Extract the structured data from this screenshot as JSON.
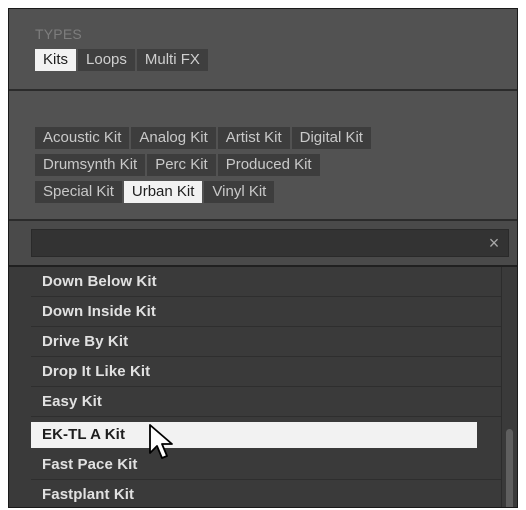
{
  "types": {
    "section_label": "TYPES",
    "items": [
      {
        "label": "Kits",
        "selected": true
      },
      {
        "label": "Loops",
        "selected": false
      },
      {
        "label": "Multi FX",
        "selected": false
      }
    ]
  },
  "tags": {
    "row1": [
      {
        "label": "Acoustic Kit",
        "selected": false
      },
      {
        "label": "Analog Kit",
        "selected": false
      },
      {
        "label": "Artist Kit",
        "selected": false
      },
      {
        "label": "Digital Kit",
        "selected": false
      }
    ],
    "row2": [
      {
        "label": "Drumsynth Kit",
        "selected": false
      },
      {
        "label": "Perc Kit",
        "selected": false
      },
      {
        "label": "Produced Kit",
        "selected": false
      }
    ],
    "row3": [
      {
        "label": "Special Kit",
        "selected": false
      },
      {
        "label": "Urban Kit",
        "selected": true
      },
      {
        "label": "Vinyl Kit",
        "selected": false
      }
    ]
  },
  "search": {
    "value": "",
    "placeholder": "",
    "clear_glyph": "×"
  },
  "results": [
    {
      "label": "Down Below Kit",
      "selected": false
    },
    {
      "label": "Down Inside Kit",
      "selected": false
    },
    {
      "label": "Drive By Kit",
      "selected": false
    },
    {
      "label": "Drop It Like Kit",
      "selected": false
    },
    {
      "label": "Easy Kit",
      "selected": false
    },
    {
      "label": "EK-TL A Kit",
      "selected": true
    },
    {
      "label": "Fast Pace Kit",
      "selected": false
    },
    {
      "label": "Fastplant Kit",
      "selected": false
    }
  ],
  "icons": {
    "clear": "close-icon",
    "pointer": "mouse-pointer-icon"
  },
  "colors": {
    "panel_bg": "#525252",
    "list_bg": "#3a3a3a",
    "selected_bg": "#f2f2f2",
    "tag_bg": "#3d3d3d"
  }
}
